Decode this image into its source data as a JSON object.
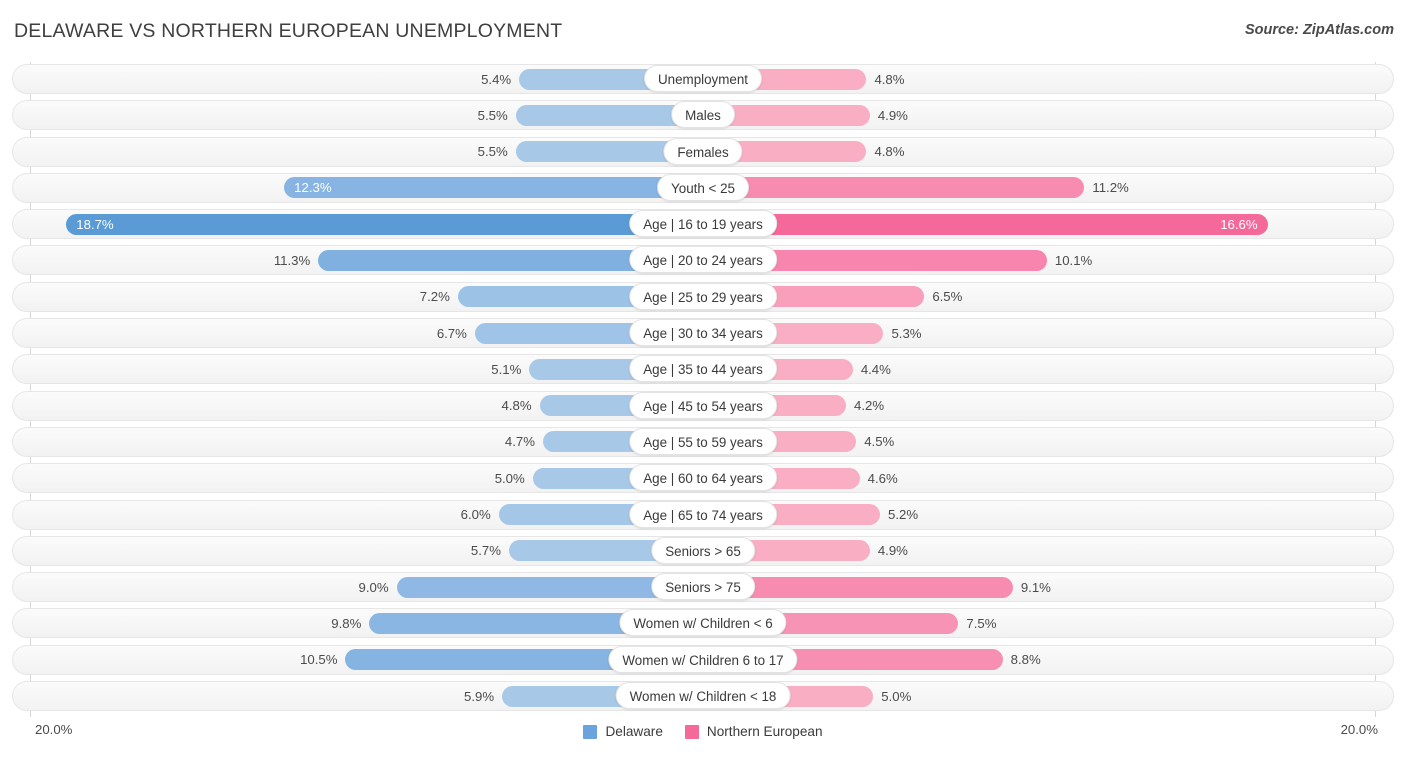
{
  "header": {
    "title": "DELAWARE VS NORTHERN EUROPEAN UNEMPLOYMENT",
    "source": "Source: ZipAtlas.com"
  },
  "axis": {
    "left_max_label": "20.0%",
    "right_max_label": "20.0%",
    "max_value": 20.0
  },
  "legend": {
    "items": [
      {
        "label": "Delaware",
        "color": "#6aa3dd"
      },
      {
        "label": "Northern European",
        "color": "#f4699a"
      }
    ]
  },
  "chart_data": {
    "type": "bar",
    "title": "DELAWARE VS NORTHERN EUROPEAN UNEMPLOYMENT",
    "subtitle": "",
    "xlabel": "",
    "ylabel": "",
    "orientation": "horizontal-diverging",
    "axis_max": 20.0,
    "axis_tick_labels": [
      "20.0%",
      "20.0%"
    ],
    "grid": false,
    "legend_position": "bottom-center",
    "categories": [
      "Unemployment",
      "Males",
      "Females",
      "Youth < 25",
      "Age | 16 to 19 years",
      "Age | 20 to 24 years",
      "Age | 25 to 29 years",
      "Age | 30 to 34 years",
      "Age | 35 to 44 years",
      "Age | 45 to 54 years",
      "Age | 55 to 59 years",
      "Age | 60 to 64 years",
      "Age | 65 to 74 years",
      "Seniors > 65",
      "Seniors > 75",
      "Women w/ Children < 6",
      "Women w/ Children 6 to 17",
      "Women w/ Children < 18"
    ],
    "series": [
      {
        "name": "Delaware",
        "side": "left",
        "values": [
          5.4,
          5.5,
          5.5,
          12.3,
          18.7,
          11.3,
          7.2,
          6.7,
          5.1,
          4.8,
          4.7,
          5.0,
          6.0,
          5.7,
          9.0,
          9.8,
          10.5,
          5.9
        ],
        "labels": [
          "5.4%",
          "5.5%",
          "5.5%",
          "12.3%",
          "18.7%",
          "11.3%",
          "7.2%",
          "6.7%",
          "5.1%",
          "4.8%",
          "4.7%",
          "5.0%",
          "6.0%",
          "5.7%",
          "9.0%",
          "9.8%",
          "10.5%",
          "5.9%"
        ]
      },
      {
        "name": "Northern European",
        "side": "right",
        "values": [
          4.8,
          4.9,
          4.8,
          11.2,
          16.6,
          10.1,
          6.5,
          5.3,
          4.4,
          4.2,
          4.5,
          4.6,
          5.2,
          4.9,
          9.1,
          7.5,
          8.8,
          5.0
        ],
        "labels": [
          "4.8%",
          "4.9%",
          "4.8%",
          "11.2%",
          "16.6%",
          "10.1%",
          "6.5%",
          "5.3%",
          "4.4%",
          "4.2%",
          "4.5%",
          "4.6%",
          "5.2%",
          "4.9%",
          "9.1%",
          "7.5%",
          "8.8%",
          "5.0%"
        ]
      }
    ]
  },
  "rows": [
    {
      "label": "Unemployment",
      "left_label": "5.4%",
      "right_label": "4.8%",
      "left_value": 5.4,
      "right_value": 4.8,
      "left_color": "#a8c8e8",
      "right_color": "#f9aec4",
      "left_inside": false,
      "right_inside": false
    },
    {
      "label": "Males",
      "left_label": "5.5%",
      "right_label": "4.9%",
      "left_value": 5.5,
      "right_value": 4.9,
      "left_color": "#a8c8e8",
      "right_color": "#f9aec4",
      "left_inside": false,
      "right_inside": false
    },
    {
      "label": "Females",
      "left_label": "5.5%",
      "right_label": "4.8%",
      "left_value": 5.5,
      "right_value": 4.8,
      "left_color": "#a8c8e8",
      "right_color": "#f9aec4",
      "left_inside": false,
      "right_inside": false
    },
    {
      "label": "Youth < 25",
      "left_label": "12.3%",
      "right_label": "11.2%",
      "left_value": 12.3,
      "right_value": 11.2,
      "left_color": "#87b4e2",
      "right_color": "#f88cb0",
      "left_inside": true,
      "right_inside": false
    },
    {
      "label": "Age | 16 to 19 years",
      "left_label": "18.7%",
      "right_label": "16.6%",
      "left_value": 18.7,
      "right_value": 16.6,
      "left_color": "#5b9bd5",
      "right_color": "#f4699a",
      "left_inside": true,
      "right_inside": true
    },
    {
      "label": "Age | 20 to 24 years",
      "left_label": "11.3%",
      "right_label": "10.1%",
      "left_value": 11.3,
      "right_value": 10.1,
      "left_color": "#7fb0e0",
      "right_color": "#f785ad",
      "left_inside": false,
      "right_inside": false
    },
    {
      "label": "Age | 25 to 29 years",
      "left_label": "7.2%",
      "right_label": "6.5%",
      "left_value": 7.2,
      "right_value": 6.5,
      "left_color": "#9cc2e6",
      "right_color": "#f99ebb",
      "left_inside": false,
      "right_inside": false
    },
    {
      "label": "Age | 30 to 34 years",
      "left_label": "6.7%",
      "right_label": "5.3%",
      "left_value": 6.7,
      "right_value": 5.3,
      "left_color": "#a0c4e7",
      "right_color": "#f9aec4",
      "left_inside": false,
      "right_inside": false
    },
    {
      "label": "Age | 35 to 44 years",
      "left_label": "5.1%",
      "right_label": "4.4%",
      "left_value": 5.1,
      "right_value": 4.4,
      "left_color": "#a8c8e8",
      "right_color": "#f9aec4",
      "left_inside": false,
      "right_inside": false
    },
    {
      "label": "Age | 45 to 54 years",
      "left_label": "4.8%",
      "right_label": "4.2%",
      "left_value": 4.8,
      "right_value": 4.2,
      "left_color": "#a8c8e8",
      "right_color": "#f9aec4",
      "left_inside": false,
      "right_inside": false
    },
    {
      "label": "Age | 55 to 59 years",
      "left_label": "4.7%",
      "right_label": "4.5%",
      "left_value": 4.7,
      "right_value": 4.5,
      "left_color": "#a8c8e8",
      "right_color": "#f9aec4",
      "left_inside": false,
      "right_inside": false
    },
    {
      "label": "Age | 60 to 64 years",
      "left_label": "5.0%",
      "right_label": "4.6%",
      "left_value": 5.0,
      "right_value": 4.6,
      "left_color": "#a8c8e8",
      "right_color": "#f9aec4",
      "left_inside": false,
      "right_inside": false
    },
    {
      "label": "Age | 65 to 74 years",
      "left_label": "6.0%",
      "right_label": "5.2%",
      "left_value": 6.0,
      "right_value": 5.2,
      "left_color": "#a4c6e7",
      "right_color": "#f9aec4",
      "left_inside": false,
      "right_inside": false
    },
    {
      "label": "Seniors > 65",
      "left_label": "5.7%",
      "right_label": "4.9%",
      "left_value": 5.7,
      "right_value": 4.9,
      "left_color": "#a8c8e8",
      "right_color": "#f9aec4",
      "left_inside": false,
      "right_inside": false
    },
    {
      "label": "Seniors > 75",
      "left_label": "9.0%",
      "right_label": "9.1%",
      "left_value": 9.0,
      "right_value": 9.1,
      "left_color": "#8fb9e4",
      "right_color": "#f88cb0",
      "left_inside": false,
      "right_inside": false
    },
    {
      "label": "Women w/ Children < 6",
      "left_label": "9.8%",
      "right_label": "7.5%",
      "left_value": 9.8,
      "right_value": 7.5,
      "left_color": "#8ab6e3",
      "right_color": "#f794b5",
      "left_inside": false,
      "right_inside": false
    },
    {
      "label": "Women w/ Children 6 to 17",
      "left_label": "10.5%",
      "right_label": "8.8%",
      "left_value": 10.5,
      "right_value": 8.8,
      "left_color": "#85b3e2",
      "right_color": "#f78fb2",
      "left_inside": false,
      "right_inside": false
    },
    {
      "label": "Women w/ Children < 18",
      "left_label": "5.9%",
      "right_label": "5.0%",
      "left_value": 5.9,
      "right_value": 5.0,
      "left_color": "#a8c8e8",
      "right_color": "#f9aec4",
      "left_inside": false,
      "right_inside": false
    }
  ]
}
